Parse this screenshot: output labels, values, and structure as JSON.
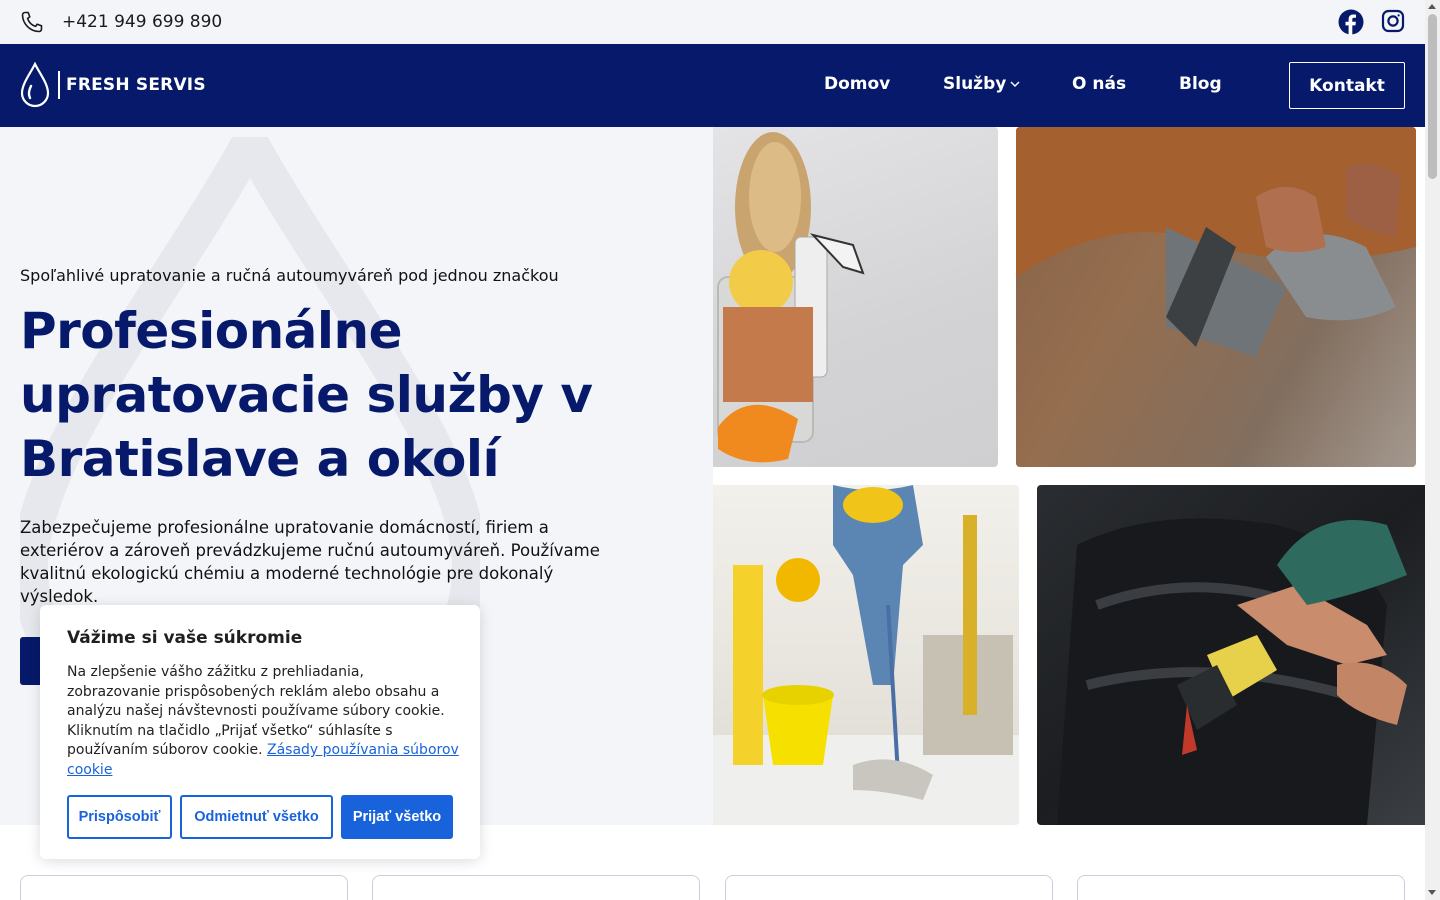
{
  "topbar": {
    "phone": "+421 949 699 890"
  },
  "nav": {
    "brand": "FRESH SERVIS",
    "items": [
      {
        "label": "Domov"
      },
      {
        "label": "Služby"
      },
      {
        "label": "O nás"
      },
      {
        "label": "Blog"
      }
    ],
    "cta": "Kontakt"
  },
  "hero": {
    "tagline": "Spoľahlivé upratovanie a ručná autoumyváreň pod jednou značkou",
    "headline": "Profesionálne upratovacie služby v Bratislave a okolí",
    "description": "Zabezpečujeme profesionálne upratovanie domácností, firiem a exteriérov a zároveň prevádzkujeme ručnú autoumyváreň. Používame kvalitnú ekologickú chémiu a moderné technológie pre dokonalý výsledok."
  },
  "cookie": {
    "title": "Vážime si vaše súkromie",
    "text": "Na zlepšenie vášho zážitku z prehliadania, zobrazovanie prispôsobených reklám alebo obsahu a analýzu našej návštevnosti používame súbory cookie. Kliknutím na tlačidlo „Prijať všetko“ súhlasíte s používaním súborov cookie.",
    "link": "Zásady používania súborov cookie",
    "buttons": {
      "customize": "Prispôsobiť",
      "reject": "Odmietnuť všetko",
      "accept": "Prijať všetko"
    }
  },
  "colors": {
    "navy": "#06196a",
    "cookie_blue": "#1863dc",
    "hero_bg": "#f3f5f9"
  },
  "icons": [
    "phone-icon",
    "facebook-icon",
    "instagram-icon",
    "water-drop-logo-icon",
    "chevron-down-icon"
  ]
}
